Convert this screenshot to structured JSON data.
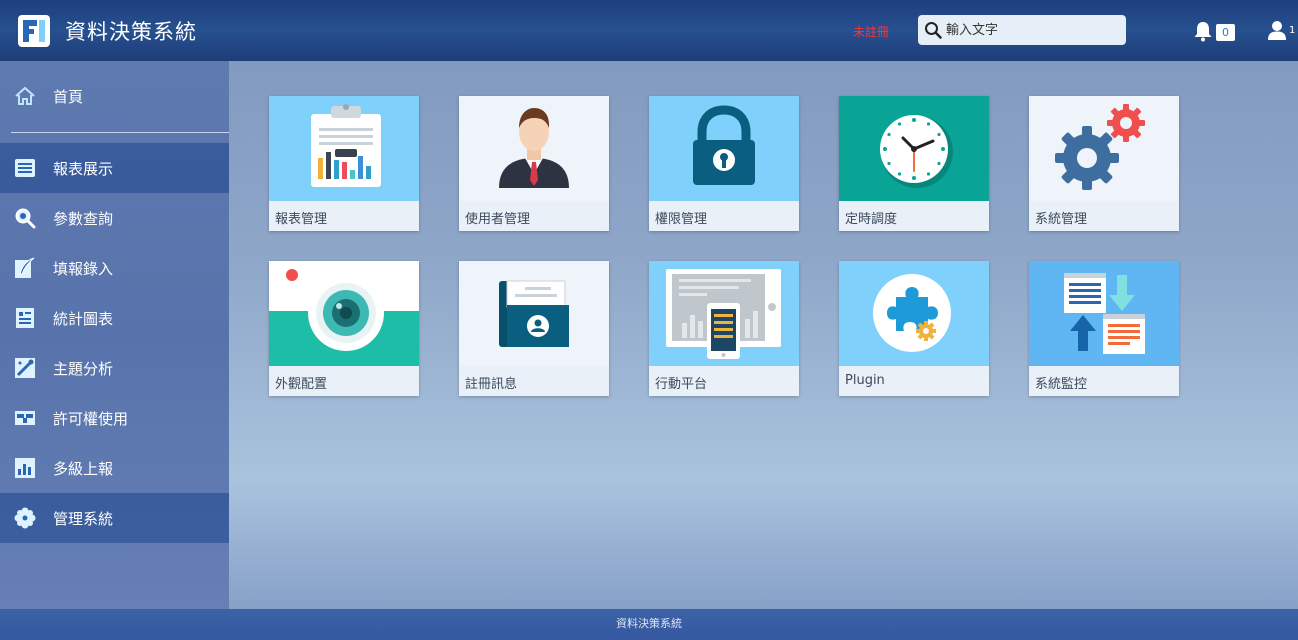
{
  "header": {
    "title": "資料決策系統",
    "status": "未註冊",
    "search_placeholder": "輸入文字",
    "notification_count": "0",
    "user_count": "1"
  },
  "sidebar": {
    "items": [
      {
        "label": "首頁",
        "icon": "home-icon"
      },
      {
        "label": "報表展示",
        "icon": "report-list-icon"
      },
      {
        "label": "參數查詢",
        "icon": "magnifier-icon"
      },
      {
        "label": "填報錄入",
        "icon": "feather-pen-icon"
      },
      {
        "label": "統計圖表",
        "icon": "chart-doc-icon"
      },
      {
        "label": "主題分析",
        "icon": "wand-icon"
      },
      {
        "label": "許可權使用",
        "icon": "permission-icon"
      },
      {
        "label": "多級上報",
        "icon": "bar-chart-icon"
      },
      {
        "label": "管理系統",
        "icon": "flower-gear-icon"
      }
    ]
  },
  "tiles": [
    {
      "label": "報表管理",
      "icon": "clipboard-chart-icon"
    },
    {
      "label": "使用者管理",
      "icon": "businessman-icon"
    },
    {
      "label": "權限管理",
      "icon": "padlock-icon"
    },
    {
      "label": "定時調度",
      "icon": "clock-icon"
    },
    {
      "label": "系統管理",
      "icon": "gears-icon"
    },
    {
      "label": "外觀配置",
      "icon": "camera-icon"
    },
    {
      "label": "註冊訊息",
      "icon": "id-card-icon"
    },
    {
      "label": "行動平台",
      "icon": "mobile-tablet-icon"
    },
    {
      "label": "Plugin",
      "icon": "puzzle-icon"
    },
    {
      "label": "系統監控",
      "icon": "sync-docs-icon"
    }
  ],
  "footer": {
    "text": "資料決策系統"
  },
  "colors": {
    "header_bg": "#27508f",
    "sidebar_bg": "#5f7ab1",
    "status_red": "#ff3333",
    "tile_sky": "#7fd0fb",
    "tile_teal": "#0aa496"
  }
}
